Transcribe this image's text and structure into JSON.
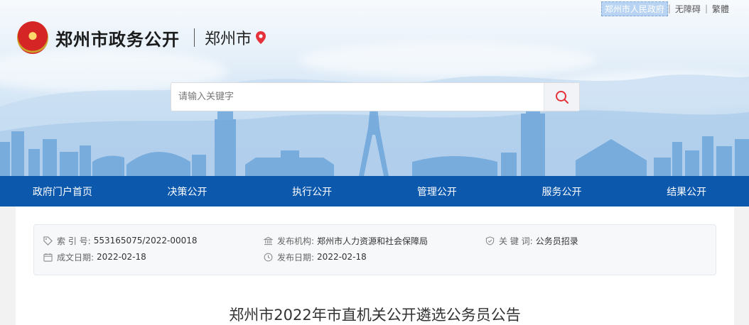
{
  "top_links": [
    {
      "label": "郑州市人民政府",
      "highlight": true
    },
    {
      "label": "无障碍",
      "highlight": false
    },
    {
      "label": "繁體",
      "highlight": false
    }
  ],
  "header": {
    "site_title": "郑州市政务公开",
    "city": "郑州市"
  },
  "search": {
    "placeholder": "请输入关键字"
  },
  "nav": [
    {
      "label": "政府门户首页"
    },
    {
      "label": "决策公开"
    },
    {
      "label": "执行公开"
    },
    {
      "label": "管理公开"
    },
    {
      "label": "服务公开"
    },
    {
      "label": "结果公开"
    }
  ],
  "info": {
    "index_no": {
      "label": "索 引 号:",
      "value": "553165075/2022-00018"
    },
    "publisher": {
      "label": "发布机构:",
      "value": "郑州市人力资源和社会保障局"
    },
    "keywords": {
      "label": "关 键 词:",
      "value": "公务员招录"
    },
    "created_date": {
      "label": "成文日期:",
      "value": "2022-02-18"
    },
    "publish_date": {
      "label": "发布日期:",
      "value": "2022-02-18"
    }
  },
  "article": {
    "title": "郑州市2022年市直机关公开遴选公务员公告"
  },
  "colors": {
    "nav_bg": "#0c58ad",
    "pin_red": "#e5323a",
    "search_icon": "#e5323a"
  }
}
